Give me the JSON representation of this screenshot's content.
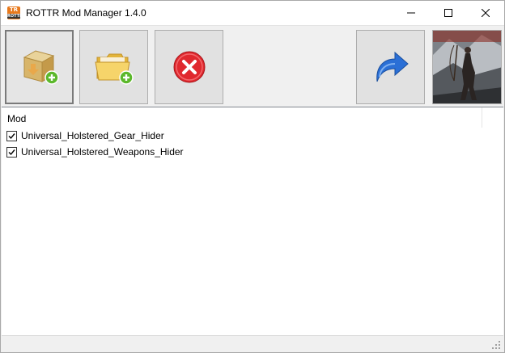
{
  "window": {
    "title": "ROTTR Mod Manager 1.4.0",
    "icon_text_top": "TR",
    "icon_text_bottom": "ROTTR"
  },
  "toolbar": {
    "buttons": [
      {
        "icon": "add-archive-icon"
      },
      {
        "icon": "add-folder-icon"
      },
      {
        "icon": "remove-icon"
      },
      {
        "icon": "launch-game-icon"
      }
    ],
    "cover_icon": "game-cover-image"
  },
  "list": {
    "column_header": "Mod",
    "items": [
      {
        "label": "Universal_Holstered_Gear_Hider",
        "checked": true
      },
      {
        "label": "Universal_Holstered_Weapons_Hider",
        "checked": true
      }
    ]
  },
  "colors": {
    "title_bg": "#ffffff",
    "toolbar_bg": "#f0f0f0",
    "button_bg": "#e1e1e1",
    "remove_red": "#e0282e",
    "launch_blue": "#2a6fd6",
    "folder_yellow": "#f2c84a",
    "plus_green": "#5cb82c"
  }
}
